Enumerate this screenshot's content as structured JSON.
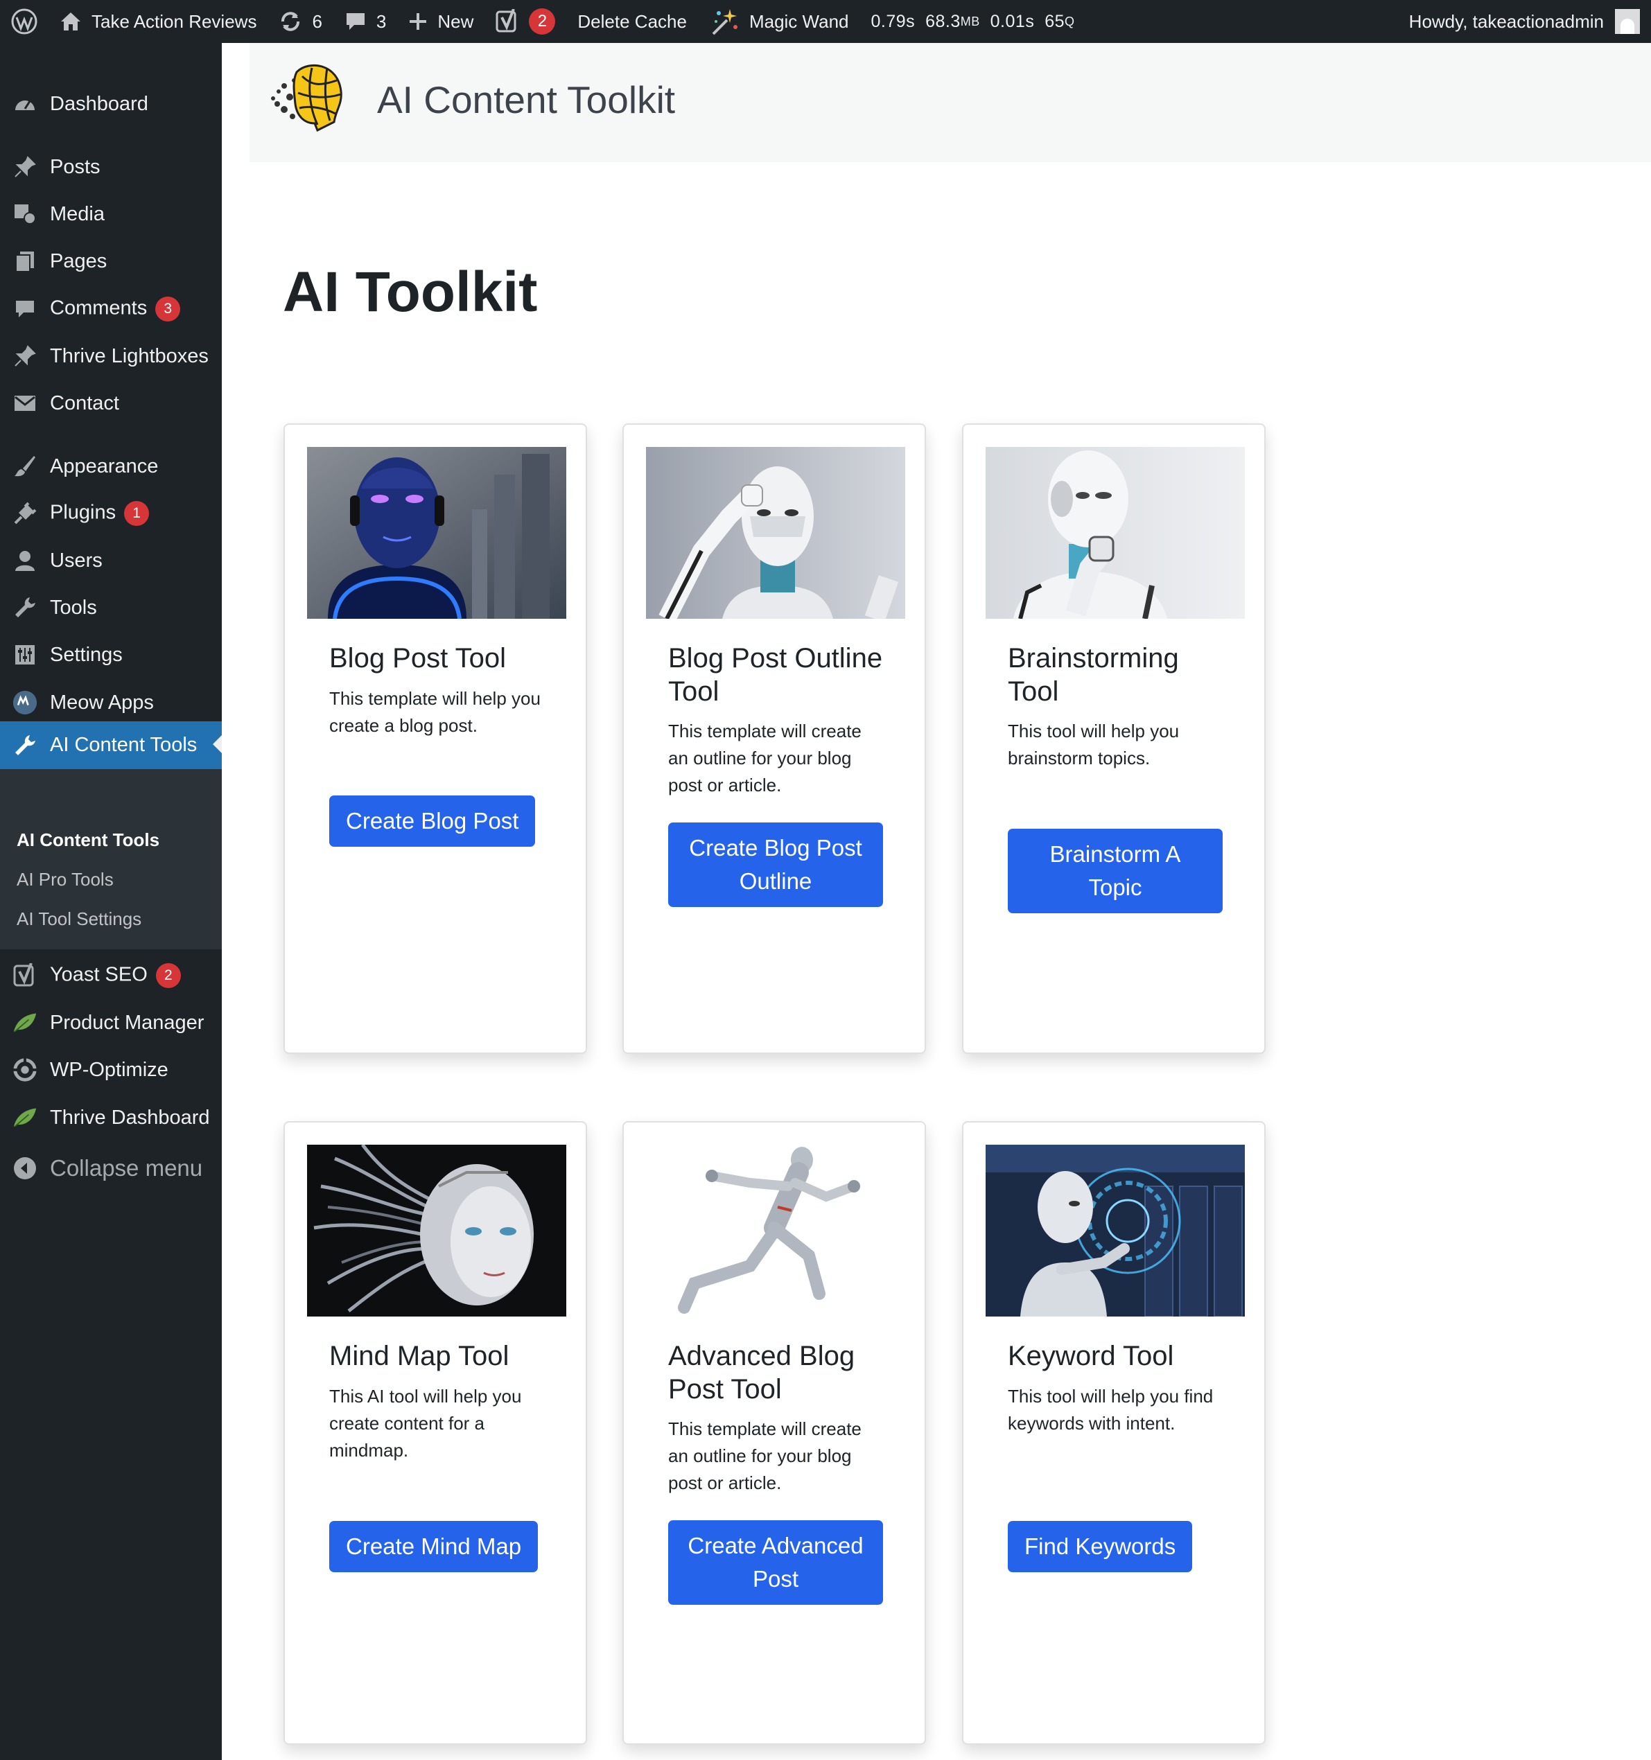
{
  "admin_bar": {
    "site_name": "Take Action Reviews",
    "updates_count": "6",
    "comments_count": "3",
    "new_label": "New",
    "yoast_badge": "2",
    "delete_cache_label": "Delete Cache",
    "magic_wand_label": "Magic Wand",
    "query_monitor": {
      "time": "0.79s",
      "memory": "68.3",
      "memory_unit": "MB",
      "db_time": "0.01s",
      "queries": "65",
      "queries_unit": "Q"
    },
    "greeting": "Howdy, takeactionadmin"
  },
  "sidebar": {
    "items": [
      {
        "label": "Dashboard",
        "icon": "dashboard-icon"
      },
      {
        "label": "Posts",
        "icon": "pin-icon"
      },
      {
        "label": "Media",
        "icon": "media-icon"
      },
      {
        "label": "Pages",
        "icon": "pages-icon"
      },
      {
        "label": "Comments",
        "icon": "comment-icon",
        "badge": "3"
      },
      {
        "label": "Thrive Lightboxes",
        "icon": "pin-icon"
      },
      {
        "label": "Contact",
        "icon": "mail-icon"
      },
      {
        "label": "Appearance",
        "icon": "brush-icon"
      },
      {
        "label": "Plugins",
        "icon": "plug-icon",
        "badge": "1"
      },
      {
        "label": "Users",
        "icon": "user-icon"
      },
      {
        "label": "Tools",
        "icon": "wrench-icon"
      },
      {
        "label": "Settings",
        "icon": "settings-icon"
      },
      {
        "label": "Meow Apps",
        "icon": "meow-icon"
      },
      {
        "label": "AI Content Tools",
        "icon": "wrench-icon"
      },
      {
        "label": "Yoast SEO",
        "icon": "yoast-icon",
        "badge": "2"
      },
      {
        "label": "Product Manager",
        "icon": "leaf-icon"
      },
      {
        "label": "WP-Optimize",
        "icon": "optimize-icon"
      },
      {
        "label": "Thrive Dashboard",
        "icon": "leaf-icon"
      }
    ],
    "submenu": [
      "AI Content Tools",
      "AI Pro Tools",
      "AI Tool Settings"
    ],
    "collapse_label": "Collapse menu"
  },
  "plugin_header": {
    "title": "AI Content Toolkit"
  },
  "page_title": "AI Toolkit",
  "cards": [
    {
      "title": "Blog Post Tool",
      "description": "This template will help you create a blog post.",
      "button": "Create Blog Post",
      "image": "robot-blue-glow"
    },
    {
      "title": "Blog Post Outline Tool",
      "description": "This template will create an outline for your blog post or article.",
      "button": "Create Blog Post Outline",
      "image": "robot-thinking-salute"
    },
    {
      "title": "Brainstorming Tool",
      "description": "This tool will help you brainstorm topics.",
      "button": "Brainstorm A Topic",
      "image": "robot-thinker"
    },
    {
      "title": "Mind Map Tool",
      "description": "This AI tool will help you create content for a mindmap.",
      "button": "Create Mind Map",
      "image": "robot-cables-head"
    },
    {
      "title": "Advanced Blog Post Tool",
      "description": "This template will create an outline for your blog post or article.",
      "button": "Create Advanced Post",
      "image": "robot-running"
    },
    {
      "title": "Keyword Tool",
      "description": "This tool will help you find keywords with intent.",
      "button": "Find Keywords",
      "image": "robot-server-room"
    }
  ],
  "colors": {
    "admin_dark": "#1d2327",
    "wp_blue": "#2271b1",
    "button_blue": "#2563eb",
    "badge_red": "#d63638"
  }
}
